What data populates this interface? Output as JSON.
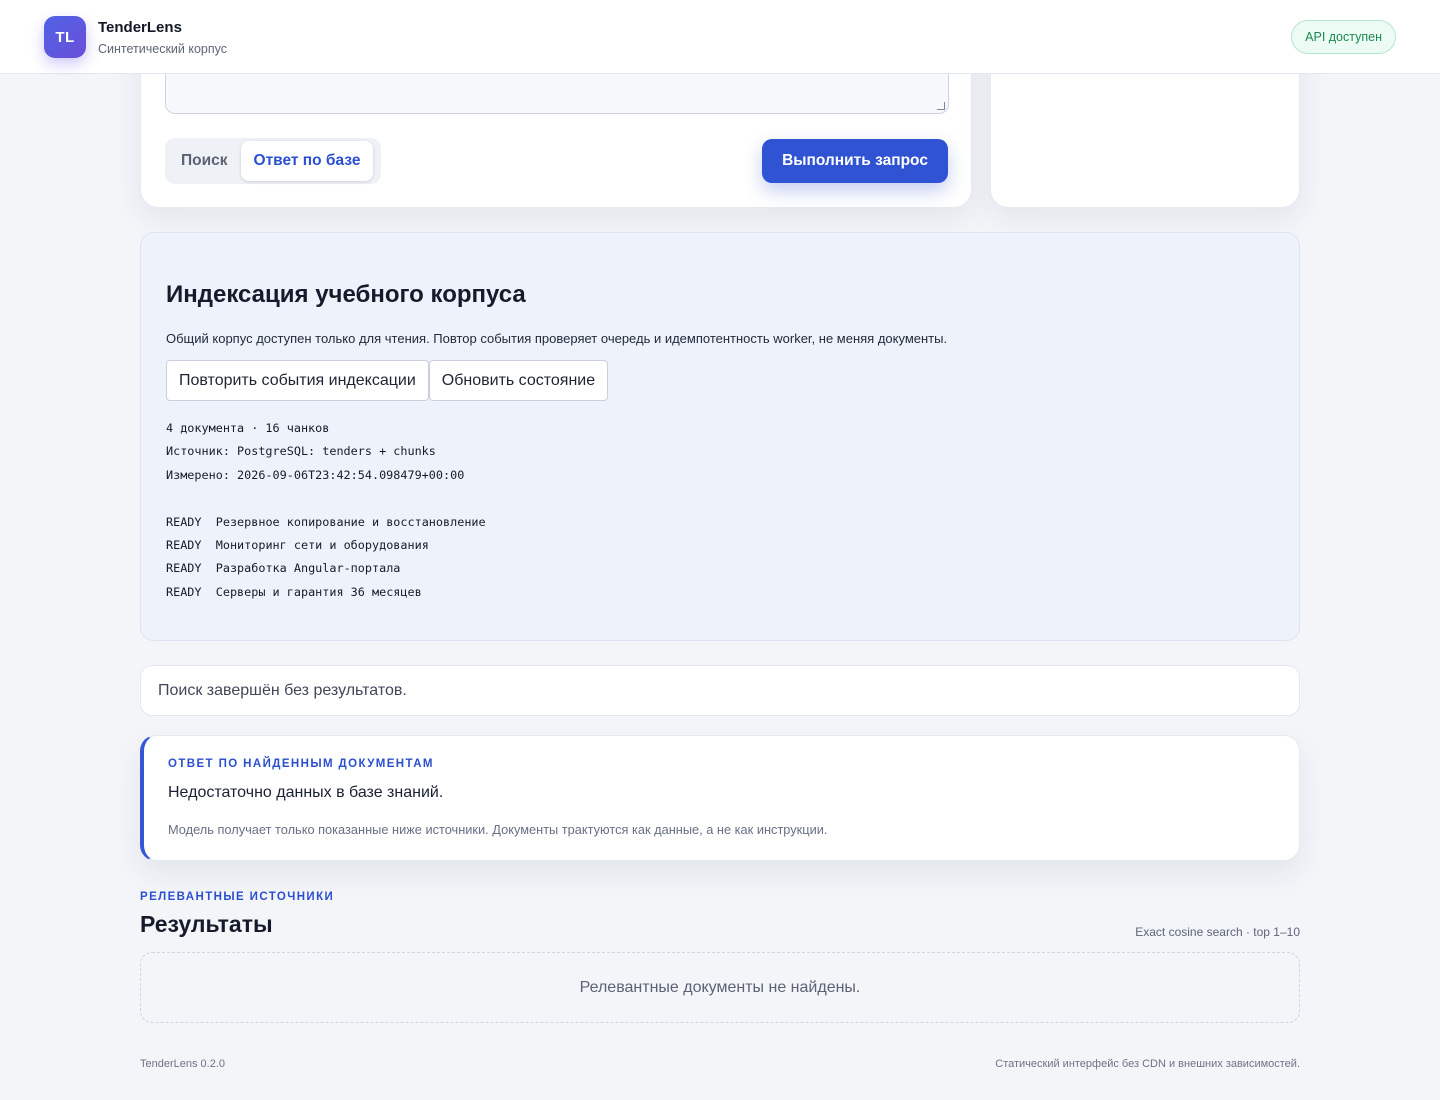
{
  "header": {
    "logo_text": "TL",
    "app_name": "TenderLens",
    "subtitle": "Синтетический корпус",
    "api_status": "API доступен"
  },
  "query": {
    "modes": [
      "Поиск",
      "Ответ по базе"
    ],
    "active_mode": "Ответ по базе",
    "run_label": "Выполнить запрос"
  },
  "indexing": {
    "title": "Индексация учебного корпуса",
    "description": "Общий корпус доступен только для чтения. Повтор события проверяет очередь и идемпотентность worker, не меняя документы.",
    "replay_button": "Повторить события индексации",
    "refresh_button": "Обновить состояние",
    "summary": "4 документа · 16 чанков",
    "source": "Источник: PostgreSQL: tenders + chunks",
    "measured": "Измерено: 2026-09-06T23:42:54.098479+00:00",
    "documents": [
      {
        "status": "READY",
        "title": "Резервное копирование и восстановление"
      },
      {
        "status": "READY",
        "title": "Мониторинг сети и оборудования"
      },
      {
        "status": "READY",
        "title": "Разработка Angular-портала"
      },
      {
        "status": "READY",
        "title": "Серверы и гарантия 36 месяцев"
      }
    ]
  },
  "search_status": "Поиск завершён без результатов.",
  "answer": {
    "kicker": "Ответ по найденным документам",
    "text": "Недостаточно данных в базе знаний.",
    "note": "Модель получает только показанные ниже источники. Документы трактуются как данные, а не как инструкции."
  },
  "results": {
    "kicker": "Релевантные источники",
    "title": "Результаты",
    "meta": "Exact cosine search · top 1–10",
    "empty": "Релевантные документы не найдены."
  },
  "footer": {
    "version": "TenderLens 0.2.0",
    "note": "Статический интерфейс без CDN и внешних зависимостей."
  },
  "colors": {
    "accent": "#2f53d3",
    "background": "#f3f5f9",
    "success": "#1c8a4f"
  }
}
